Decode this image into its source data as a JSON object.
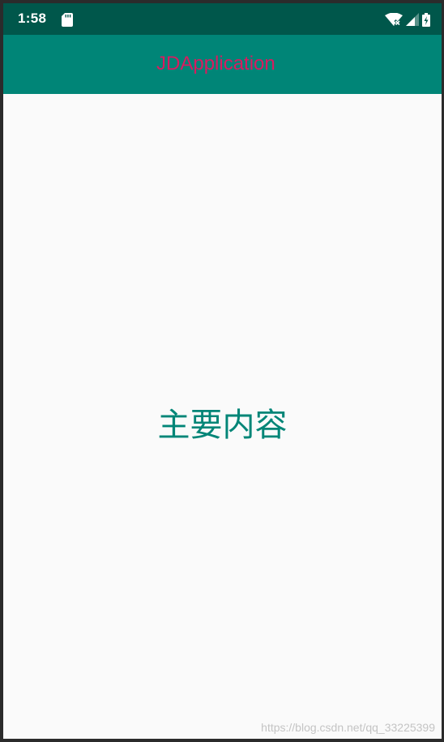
{
  "status_bar": {
    "time": "1:58",
    "icons": [
      "sd-card-icon",
      "wifi-off-icon",
      "cell-signal-icon",
      "battery-charging-icon"
    ],
    "background": "#00574b"
  },
  "app_bar": {
    "title": "JDApplication",
    "background": "#008577",
    "title_color": "#d81b60"
  },
  "main": {
    "text": "主要内容",
    "text_color": "#008577",
    "background": "#fafafa"
  },
  "watermark": {
    "text": "https://blog.csdn.net/qq_33225399"
  }
}
